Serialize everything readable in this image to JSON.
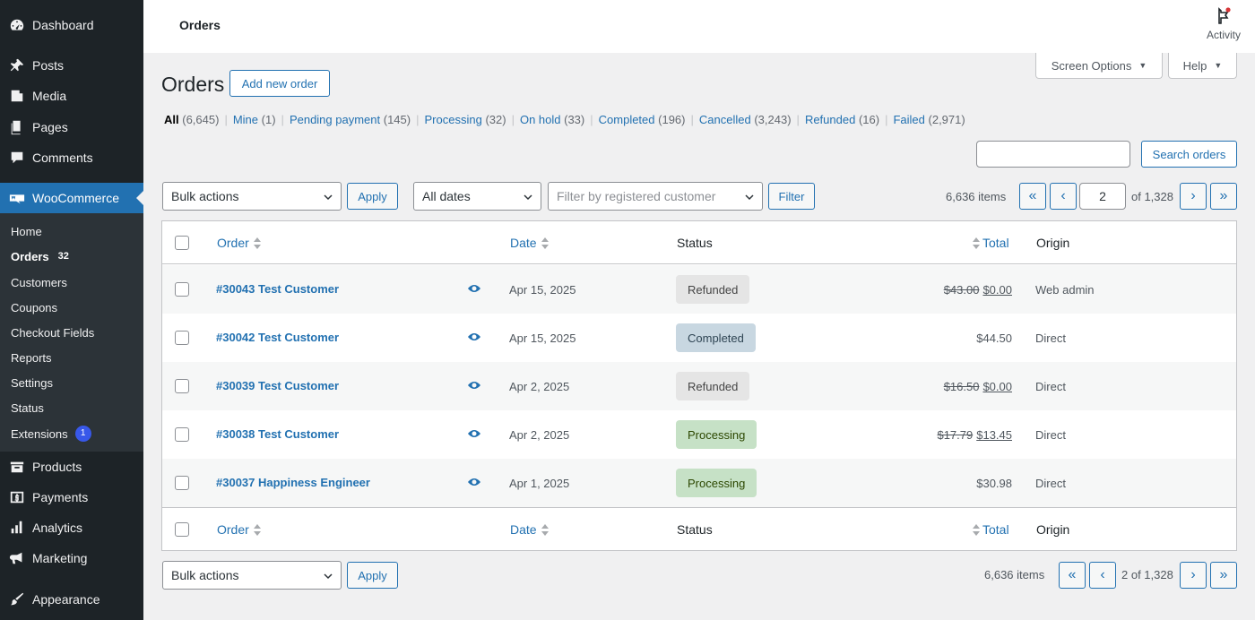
{
  "sidebar": {
    "top_items": [
      {
        "label": "Dashboard",
        "icon": "dashboard-icon"
      },
      {
        "label": "Posts",
        "icon": "pin-icon"
      },
      {
        "label": "Media",
        "icon": "media-icon"
      },
      {
        "label": "Pages",
        "icon": "pages-icon"
      },
      {
        "label": "Comments",
        "icon": "comment-icon"
      }
    ],
    "woo_label": "WooCommerce",
    "submenu": [
      {
        "label": "Home"
      },
      {
        "label": "Orders",
        "count": "32"
      },
      {
        "label": "Customers"
      },
      {
        "label": "Coupons"
      },
      {
        "label": "Checkout Fields"
      },
      {
        "label": "Reports"
      },
      {
        "label": "Settings"
      },
      {
        "label": "Status"
      },
      {
        "label": "Extensions",
        "badge": "1"
      }
    ],
    "bottom_items": [
      {
        "label": "Products",
        "icon": "products-icon"
      },
      {
        "label": "Payments",
        "icon": "payments-icon"
      },
      {
        "label": "Analytics",
        "icon": "analytics-icon"
      },
      {
        "label": "Marketing",
        "icon": "megaphone-icon"
      },
      {
        "label": "Appearance",
        "icon": "brush-icon"
      }
    ]
  },
  "header": {
    "title": "Orders",
    "activity_label": "Activity"
  },
  "screen_options_label": "Screen Options",
  "help_label": "Help",
  "page": {
    "title": "Orders",
    "add_new_label": "Add new order"
  },
  "filters": [
    {
      "label": "All",
      "count": "(6,645)",
      "current": true
    },
    {
      "label": "Mine",
      "count": "(1)"
    },
    {
      "label": "Pending payment",
      "count": "(145)"
    },
    {
      "label": "Processing",
      "count": "(32)"
    },
    {
      "label": "On hold",
      "count": "(33)"
    },
    {
      "label": "Completed",
      "count": "(196)"
    },
    {
      "label": "Cancelled",
      "count": "(3,243)"
    },
    {
      "label": "Refunded",
      "count": "(16)"
    },
    {
      "label": "Failed",
      "count": "(2,971)"
    }
  ],
  "search": {
    "value": "",
    "button_label": "Search orders"
  },
  "toolbar": {
    "bulk_actions": "Bulk actions",
    "apply_label": "Apply",
    "all_dates": "All dates",
    "customer_placeholder": "Filter by registered customer",
    "filter_label": "Filter"
  },
  "pagination": {
    "items_text": "6,636 items",
    "current_page": "2",
    "of_text": "of 1,328",
    "bottom_text": "2 of 1,328",
    "first": "«",
    "prev": "‹",
    "next": "›",
    "last": "»"
  },
  "table": {
    "columns": {
      "order": "Order",
      "date": "Date",
      "status": "Status",
      "total": "Total",
      "origin": "Origin"
    },
    "rows": [
      {
        "order": "#30043 Test Customer",
        "date": "Apr 15, 2025",
        "status": "Refunded",
        "total_old": "$43.00",
        "total": "$0.00",
        "origin": "Web admin"
      },
      {
        "order": "#30042 Test Customer",
        "date": "Apr 15, 2025",
        "status": "Completed",
        "total_old": "",
        "total": "$44.50",
        "origin": "Direct"
      },
      {
        "order": "#30039 Test Customer",
        "date": "Apr 2, 2025",
        "status": "Refunded",
        "total_old": "$16.50",
        "total": "$0.00",
        "origin": "Direct"
      },
      {
        "order": "#30038 Test Customer",
        "date": "Apr 2, 2025",
        "status": "Processing",
        "total_old": "$17.79",
        "total": "$13.45",
        "origin": "Direct"
      },
      {
        "order": "#30037 Happiness Engineer",
        "date": "Apr 1, 2025",
        "status": "Processing",
        "total_old": "",
        "total": "$30.98",
        "origin": "Direct"
      }
    ]
  },
  "colors": {
    "accent": "#2271b1",
    "sidebar_bg": "#1d2327",
    "submenu_bg": "#2c3338",
    "refunded_bg": "#e5e5e5",
    "completed_bg": "#c8d7e1",
    "processing_bg": "#c6e1c6"
  }
}
